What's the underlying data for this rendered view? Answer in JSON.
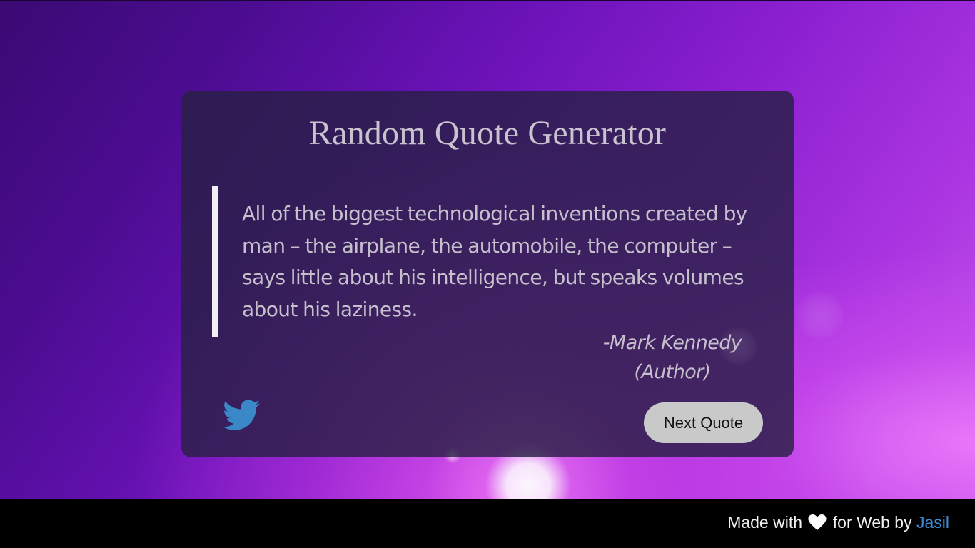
{
  "card": {
    "title": "Random Quote Generator",
    "quote": "All of the biggest technological inventions created by man – the airplane, the automobile, the computer – says little about his intelligence, but speaks volumes about his laziness.",
    "author_name": "-Mark Kennedy",
    "author_role": "(Author)",
    "tweet_icon": "twitter-bird-icon",
    "next_button_label": "Next Quote"
  },
  "footer": {
    "made_with": "Made with",
    "heart_icon": "heart-icon",
    "for_web_by": "for Web by",
    "author_link": "Jasil"
  },
  "colors": {
    "twitter_blue": "#3b88c8",
    "link_blue": "#3f8bd6",
    "button_bg": "#c9c9c9",
    "footer_bg": "#000000"
  }
}
